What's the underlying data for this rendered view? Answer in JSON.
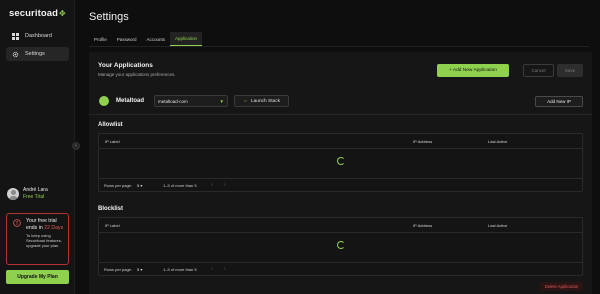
{
  "sidebar": {
    "logo": "securitoad",
    "logo_mark": "✥",
    "items": [
      {
        "label": "Dashboard",
        "icon": "grid-icon"
      },
      {
        "label": "Settings",
        "icon": "gear-icon"
      }
    ],
    "user": {
      "name": "André Lara",
      "plan": "Free Trial"
    },
    "trial": {
      "title_prefix": "Your free trial ends in",
      "days": "22 Days",
      "description": "To keep using Securitoad features, upgrade your plan."
    },
    "upgrade_label": "Upgrade My Plan",
    "collapse_glyph": "‹"
  },
  "header": {
    "title": "Settings"
  },
  "tabs": [
    {
      "label": "Profile"
    },
    {
      "label": "Password"
    },
    {
      "label": "Accounts"
    },
    {
      "label": "Application",
      "active": true
    }
  ],
  "main": {
    "title": "Your Applications",
    "subtitle": "Manage your applications preferences.",
    "add_app_label": "+ Add New Application",
    "cancel_label": "Cancel",
    "save_label": "Save",
    "app": {
      "name": "Metaltoad",
      "environment": "metaltoad-com",
      "launch_label": "Launch Stack",
      "add_ip_label": "Add New IP"
    },
    "allowlist": {
      "title": "Allowlist",
      "columns": [
        "IP Label",
        "IP Address",
        "Last Active"
      ],
      "rows_per_page_label": "Rows per page:",
      "rows_per_page_value": "5",
      "range": "1–5 of more than 5"
    },
    "blocklist": {
      "title": "Blocklist",
      "columns": [
        "IP Label",
        "IP Address",
        "Last Active"
      ],
      "rows_per_page_label": "Rows per page:",
      "rows_per_page_value": "5",
      "range": "1–5 of more than 5"
    },
    "delete_label": "Delete Application"
  },
  "colors": {
    "accent": "#8fd14f",
    "danger": "#e05a56",
    "background": "#0e0e0e"
  }
}
